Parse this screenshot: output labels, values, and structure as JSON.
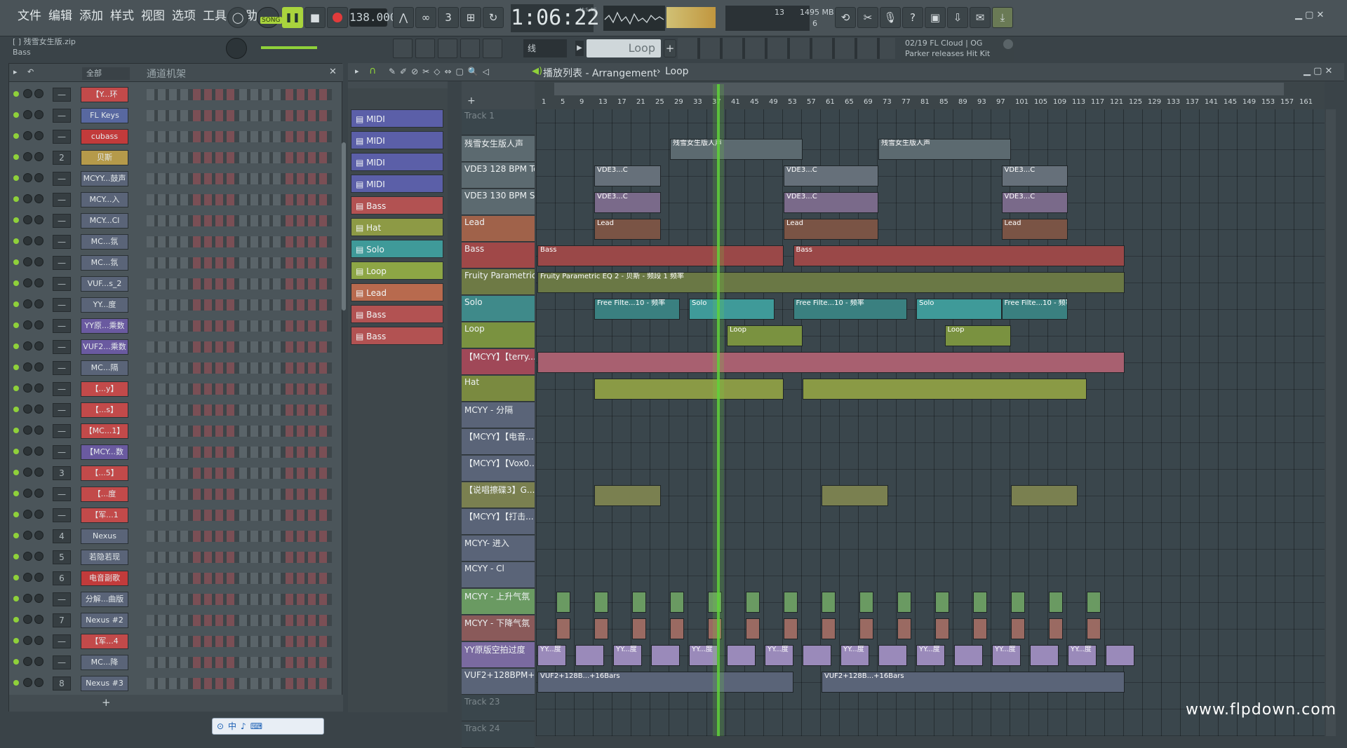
{
  "menu": [
    "文件",
    "编辑",
    "添加",
    "样式",
    "视图",
    "选项",
    "工具",
    "帮助"
  ],
  "transport": {
    "song_label": "SONG",
    "tempo": "138.000",
    "time": "1:06:22",
    "time_label": "M:S:CS"
  },
  "cpu": {
    "cpu_value": "13",
    "memory": "1495 MB",
    "voices": "6"
  },
  "hint": {
    "file": "[ ] 残雪女生版.zip",
    "channel": "Bass"
  },
  "snap": "线",
  "pattern": "Loop",
  "news": {
    "line1": "02/19  FL Cloud | OG",
    "line2": "Parker releases Hit Kit"
  },
  "rack": {
    "title": "通道机架",
    "filter": "全部",
    "channels": [
      {
        "num": "—",
        "name": "【Y...环",
        "color": "#c24a4a"
      },
      {
        "num": "—",
        "name": "FL Keys",
        "color": "#5868a0"
      },
      {
        "num": "—",
        "name": "cubass",
        "color": "#c23b3b"
      },
      {
        "num": "2",
        "name": "贝斯",
        "color": "#b59a4a"
      },
      {
        "num": "—",
        "name": "MCYY...鼓声",
        "color": "#5a6478"
      },
      {
        "num": "—",
        "name": "MCY...入",
        "color": "#5a6478"
      },
      {
        "num": "—",
        "name": "MCY...Cl",
        "color": "#5a6478"
      },
      {
        "num": "—",
        "name": "MC...氛",
        "color": "#5a6478"
      },
      {
        "num": "—",
        "name": "MC...氛",
        "color": "#5a6478"
      },
      {
        "num": "—",
        "name": "VUF...s_2",
        "color": "#5a6478"
      },
      {
        "num": "—",
        "name": "YY...度",
        "color": "#5a6478"
      },
      {
        "num": "—",
        "name": "YY原...乘数",
        "color": "#6a5aa0"
      },
      {
        "num": "—",
        "name": "VUF2...乘数",
        "color": "#6a5aa0"
      },
      {
        "num": "—",
        "name": "MC...隔",
        "color": "#5a6478"
      },
      {
        "num": "—",
        "name": "【...y】",
        "color": "#c24a4a"
      },
      {
        "num": "—",
        "name": "【...s】",
        "color": "#c24a4a"
      },
      {
        "num": "—",
        "name": "【MC...1】",
        "color": "#c24a4a"
      },
      {
        "num": "—",
        "name": "【MCY...数",
        "color": "#6a5aa0"
      },
      {
        "num": "3",
        "name": "【...5】",
        "color": "#c24a4a"
      },
      {
        "num": "—",
        "name": "【...度",
        "color": "#c24a4a"
      },
      {
        "num": "—",
        "name": "【军...1",
        "color": "#c24a4a"
      },
      {
        "num": "4",
        "name": "Nexus",
        "color": "#5a6478"
      },
      {
        "num": "5",
        "name": "若隐若现",
        "color": "#5a6478"
      },
      {
        "num": "6",
        "name": "电音副歌",
        "color": "#c23b3b"
      },
      {
        "num": "—",
        "name": "分解...曲版",
        "color": "#5a6478"
      },
      {
        "num": "7",
        "name": "Nexus #2",
        "color": "#5a6478"
      },
      {
        "num": "—",
        "name": "【军...4",
        "color": "#c24a4a"
      },
      {
        "num": "—",
        "name": "MC...降",
        "color": "#5a6478"
      },
      {
        "num": "8",
        "name": "Nexus #3",
        "color": "#5a6478"
      }
    ]
  },
  "picker": [
    {
      "label": "MIDI",
      "color": "#5b5fa8"
    },
    {
      "label": "MIDI",
      "color": "#5b5fa8"
    },
    {
      "label": "MIDI",
      "color": "#5b5fa8"
    },
    {
      "label": "MIDI",
      "color": "#5b5fa8"
    },
    {
      "label": "Bass",
      "color": "#b25252"
    },
    {
      "label": "Hat",
      "color": "#8d9a45"
    },
    {
      "label": "Solo",
      "color": "#3f9a99"
    },
    {
      "label": "Loop",
      "color": "#8da645"
    },
    {
      "label": "Lead",
      "color": "#b86a4e"
    },
    {
      "label": "Bass",
      "color": "#b25252"
    },
    {
      "label": "Bass",
      "color": "#b25252"
    }
  ],
  "playlist": {
    "title": "播放列表 - Arrangement",
    "crumb": "Loop",
    "ticks": [
      "1",
      "5",
      "9",
      "13",
      "17",
      "21",
      "25",
      "29",
      "33",
      "37",
      "41",
      "45",
      "49",
      "53",
      "57",
      "61",
      "65",
      "69",
      "73",
      "77",
      "81",
      "85",
      "89",
      "93",
      "97",
      "101",
      "105",
      "109",
      "113",
      "117",
      "121",
      "125",
      "129",
      "133",
      "137",
      "141",
      "145",
      "149",
      "153",
      "157",
      "161"
    ],
    "tracks": [
      {
        "name": "Track 1",
        "color": "#3a464c"
      },
      {
        "name": "残雪女生版人声",
        "color": "#5c6a70"
      },
      {
        "name": "VDE3 128 BPM Tog...",
        "color": "#5c6a70"
      },
      {
        "name": "VDE3 130 BPM Sun...",
        "color": "#5c6a70"
      },
      {
        "name": "Lead",
        "color": "#a0624a"
      },
      {
        "name": "Bass",
        "color": "#a04848"
      },
      {
        "name": "Fruity Parametric...",
        "color": "#6e7a45"
      },
      {
        "name": "Solo",
        "color": "#3f8a8a"
      },
      {
        "name": "Loop",
        "color": "#7a9240"
      },
      {
        "name": "【MCYY】【terry...",
        "color": "#a04858"
      },
      {
        "name": "Hat",
        "color": "#7a8a40"
      },
      {
        "name": "MCYY - 分隔",
        "color": "#5a6478"
      },
      {
        "name": "【MCYY】【电音...",
        "color": "#5a6478"
      },
      {
        "name": "【MCYY】【Vox0...",
        "color": "#5a6478"
      },
      {
        "name": "【说唱擦碟3】G...",
        "color": "#7a8050"
      },
      {
        "name": "【MCYY】【打击...",
        "color": "#5a6478"
      },
      {
        "name": "MCYY- 进入",
        "color": "#5a6478"
      },
      {
        "name": "MCYY - Cl",
        "color": "#5a6478"
      },
      {
        "name": "MCYY - 上升气氛",
        "color": "#6a9a62"
      },
      {
        "name": "MCYY - 下降气氛",
        "color": "#8a5a5a"
      },
      {
        "name": "YY原版空拍过度",
        "color": "#7a6aa0"
      },
      {
        "name": "VUF2+128BPM+Bin...",
        "color": "#5a6478"
      },
      {
        "name": "Track 23",
        "color": "#3a464c"
      },
      {
        "name": "Track 24",
        "color": "#3a464c"
      }
    ],
    "clip_labels": {
      "vocal": "残雪女生版人声",
      "vde": "VDE3...C",
      "lead": "Lead",
      "bass": "Bass",
      "eq": "Fruity Parametric EQ 2 - 贝斯 - 频段 1 频率",
      "filter": "Free Filte...10 - 频率",
      "solo": "Solo",
      "loop": "Loop",
      "yy": "YY...度",
      "vuf": "VUF2+128B...+16Bars"
    }
  },
  "watermark": "www.flpdown.com"
}
